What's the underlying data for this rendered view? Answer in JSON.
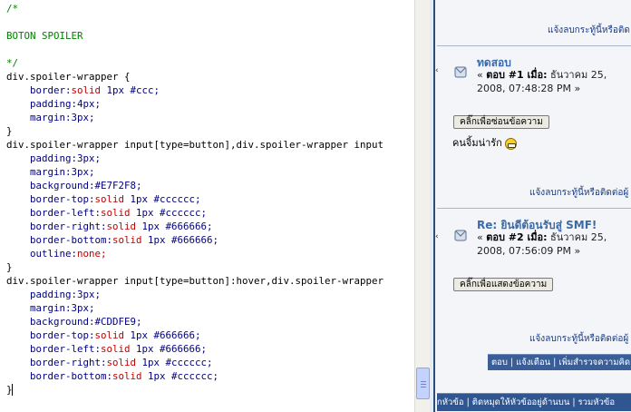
{
  "editor": {
    "code_lines": [
      [
        {
          "t": "/*",
          "c": "comment"
        }
      ],
      [],
      [
        {
          "t": "BOTON SPOILER",
          "c": "comment"
        }
      ],
      [],
      [
        {
          "t": "*/",
          "c": "comment"
        }
      ],
      [
        {
          "t": "div.spoiler-wrapper {",
          "c": "plain"
        }
      ],
      [
        {
          "t": "    ",
          "c": "plain"
        },
        {
          "t": "border:",
          "c": "prop"
        },
        {
          "t": "solid",
          "c": "val"
        },
        {
          "t": " 1px #ccc;",
          "c": "prop"
        }
      ],
      [
        {
          "t": "    ",
          "c": "plain"
        },
        {
          "t": "padding:",
          "c": "prop"
        },
        {
          "t": "4px;",
          "c": "prop"
        }
      ],
      [
        {
          "t": "    ",
          "c": "plain"
        },
        {
          "t": "margin:",
          "c": "prop"
        },
        {
          "t": "3px;",
          "c": "prop"
        }
      ],
      [
        {
          "t": "}",
          "c": "plain"
        }
      ],
      [
        {
          "t": "div.spoiler-wrapper input[type=button],div.spoiler-wrapper input",
          "c": "plain"
        }
      ],
      [
        {
          "t": "    ",
          "c": "plain"
        },
        {
          "t": "padding:",
          "c": "prop"
        },
        {
          "t": "3px;",
          "c": "prop"
        }
      ],
      [
        {
          "t": "    ",
          "c": "plain"
        },
        {
          "t": "margin:",
          "c": "prop"
        },
        {
          "t": "3px;",
          "c": "prop"
        }
      ],
      [
        {
          "t": "    ",
          "c": "plain"
        },
        {
          "t": "background:",
          "c": "prop"
        },
        {
          "t": "#E7F2F8;",
          "c": "prop"
        }
      ],
      [
        {
          "t": "    ",
          "c": "plain"
        },
        {
          "t": "border-top:",
          "c": "prop"
        },
        {
          "t": "solid",
          "c": "val"
        },
        {
          "t": " 1px #cccccc;",
          "c": "prop"
        }
      ],
      [
        {
          "t": "    ",
          "c": "plain"
        },
        {
          "t": "border-left:",
          "c": "prop"
        },
        {
          "t": "solid",
          "c": "val"
        },
        {
          "t": " 1px #cccccc;",
          "c": "prop"
        }
      ],
      [
        {
          "t": "    ",
          "c": "plain"
        },
        {
          "t": "border-right:",
          "c": "prop"
        },
        {
          "t": "solid",
          "c": "val"
        },
        {
          "t": " 1px #666666;",
          "c": "prop"
        }
      ],
      [
        {
          "t": "    ",
          "c": "plain"
        },
        {
          "t": "border-bottom:",
          "c": "prop"
        },
        {
          "t": "solid",
          "c": "val"
        },
        {
          "t": " 1px #666666;",
          "c": "prop"
        }
      ],
      [
        {
          "t": "    ",
          "c": "plain"
        },
        {
          "t": "outline:",
          "c": "prop"
        },
        {
          "t": "none;",
          "c": "val"
        }
      ],
      [
        {
          "t": "}",
          "c": "plain"
        }
      ],
      [
        {
          "t": "div.spoiler-wrapper input[type=button]:hover,div.spoiler-wrapper",
          "c": "plain"
        }
      ],
      [
        {
          "t": "    ",
          "c": "plain"
        },
        {
          "t": "padding:",
          "c": "prop"
        },
        {
          "t": "3px;",
          "c": "prop"
        }
      ],
      [
        {
          "t": "    ",
          "c": "plain"
        },
        {
          "t": "margin:",
          "c": "prop"
        },
        {
          "t": "3px;",
          "c": "prop"
        }
      ],
      [
        {
          "t": "    ",
          "c": "plain"
        },
        {
          "t": "background:",
          "c": "prop"
        },
        {
          "t": "#CDDFE9;",
          "c": "prop"
        }
      ],
      [
        {
          "t": "    ",
          "c": "plain"
        },
        {
          "t": "border-top:",
          "c": "prop"
        },
        {
          "t": "solid",
          "c": "val"
        },
        {
          "t": " 1px #666666;",
          "c": "prop"
        }
      ],
      [
        {
          "t": "    ",
          "c": "plain"
        },
        {
          "t": "border-left:",
          "c": "prop"
        },
        {
          "t": "solid",
          "c": "val"
        },
        {
          "t": " 1px #666666;",
          "c": "prop"
        }
      ],
      [
        {
          "t": "    ",
          "c": "plain"
        },
        {
          "t": "border-right:",
          "c": "prop"
        },
        {
          "t": "solid",
          "c": "val"
        },
        {
          "t": " 1px #cccccc;",
          "c": "prop"
        }
      ],
      [
        {
          "t": "    ",
          "c": "plain"
        },
        {
          "t": "border-bottom:",
          "c": "prop"
        },
        {
          "t": "solid",
          "c": "val"
        },
        {
          "t": " 1px #cccccc;",
          "c": "prop"
        }
      ],
      [
        {
          "t": "}",
          "c": "plain"
        }
      ]
    ],
    "colors": {
      "comment": "#008000",
      "property": "#000080",
      "value": "#c00000"
    }
  },
  "forum": {
    "report_link_top": "แจ้งลบกระทู้นี้หรือติด",
    "post1": {
      "title": "ทดสอบ",
      "meta_line1_prefix": "« ",
      "meta_reply": "ตอบ #1 เมื่อ:",
      "meta_line1_date": " ธันวาคม 25,",
      "meta_line2": "2008, 07:48:28 PM »",
      "spoiler_button": "คลิ๊กเพื่อซ่อนข้อความ",
      "body": "คนจิ้มน่ารัก",
      "report_link": "แจ้งลบกระทู้นี้หรือติดต่อผู้"
    },
    "post2": {
      "title": "Re: ยินดีต้อนรับสู่ SMF!",
      "meta_line1_prefix": "« ",
      "meta_reply": "ตอบ #2 เมื่อ:",
      "meta_line1_date": " ธันวาคม 25,",
      "meta_line2": "2008, 07:56:09 PM »",
      "spoiler_button": "คลิ๊กเพื่อแสดงข้อความ",
      "report_link": "แจ้งลบกระทู้นี้หรือติดต่อผู้"
    },
    "action_bar": "ตอบ | แจ้งเตือน | เพิ่มสำรวจความคิด",
    "bottom_bar": "กหัวข้อ | ติดหมุดให้หัวข้ออยู่ด้านบน | รวมหัวข้อ"
  }
}
